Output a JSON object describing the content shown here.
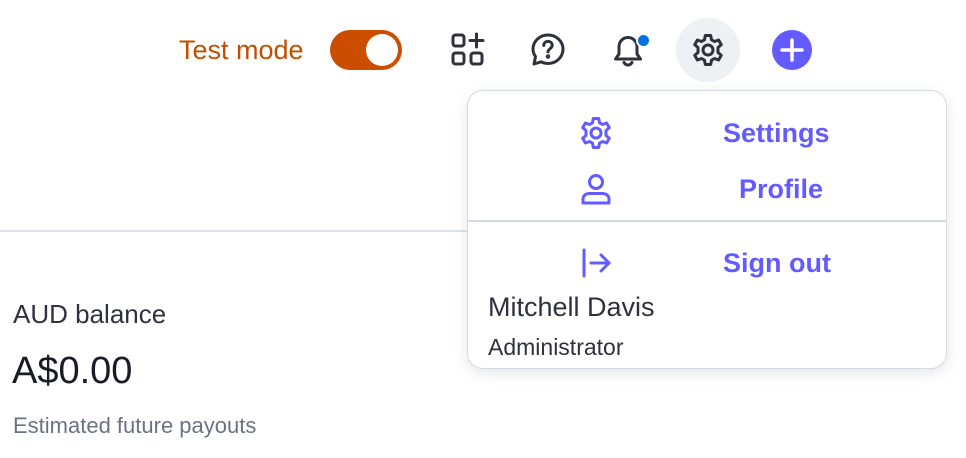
{
  "header": {
    "test_mode_label": "Test mode",
    "test_mode_enabled": true,
    "icons": [
      "apps-add-icon",
      "help-icon",
      "notification-icon",
      "settings-icon",
      "create-icon"
    ],
    "notification_unread": true
  },
  "colors": {
    "accent": "#635bff",
    "test_mode": "#cd4d00",
    "notification_dot": "#0570de"
  },
  "dropdown": {
    "items": [
      {
        "label": "Settings",
        "icon": "gear-icon"
      },
      {
        "label": "Profile",
        "icon": "person-icon"
      },
      {
        "label": "Sign out",
        "icon": "sign-out-icon"
      }
    ],
    "user_name": "Mitchell Davis",
    "user_role": "Administrator"
  },
  "balance": {
    "title": "AUD balance",
    "amount": "A$0.00",
    "subtitle": "Estimated future payouts"
  }
}
